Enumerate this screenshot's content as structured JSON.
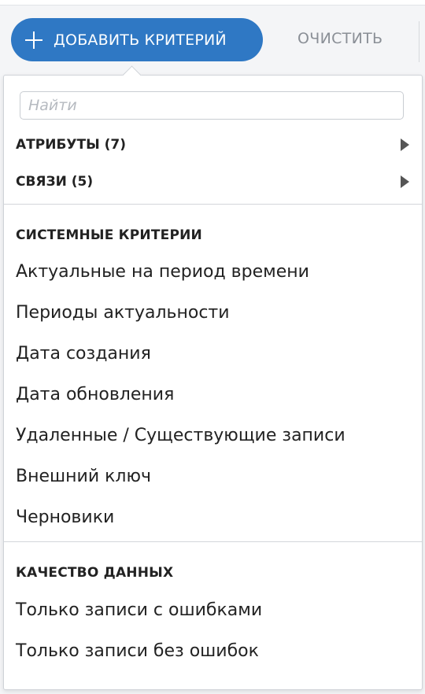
{
  "toolbar": {
    "add_label": "ДОБАВИТЬ КРИТЕРИЙ",
    "clear_label": "ОЧИСТИТЬ",
    "colors": {
      "primary": "#2f78c4",
      "muted": "#8a8f96"
    }
  },
  "menu": {
    "search_placeholder": "Найти",
    "submenus": [
      {
        "label": "АТРИБУТЫ (7)",
        "icon": "caret-right-icon"
      },
      {
        "label": "СВЯЗИ (5)",
        "icon": "caret-right-icon"
      }
    ],
    "sections": [
      {
        "title": "СИСТЕМНЫЕ КРИТЕРИИ",
        "items": [
          "Актуальные на период времени",
          "Периоды актуальности",
          "Дата создания",
          "Дата обновления",
          "Удаленные / Существующие записи",
          "Внешний ключ",
          "Черновики"
        ]
      },
      {
        "title": "КАЧЕСТВО ДАННЫХ",
        "items": [
          "Только записи с ошибками",
          "Только записи без ошибок"
        ]
      }
    ]
  }
}
